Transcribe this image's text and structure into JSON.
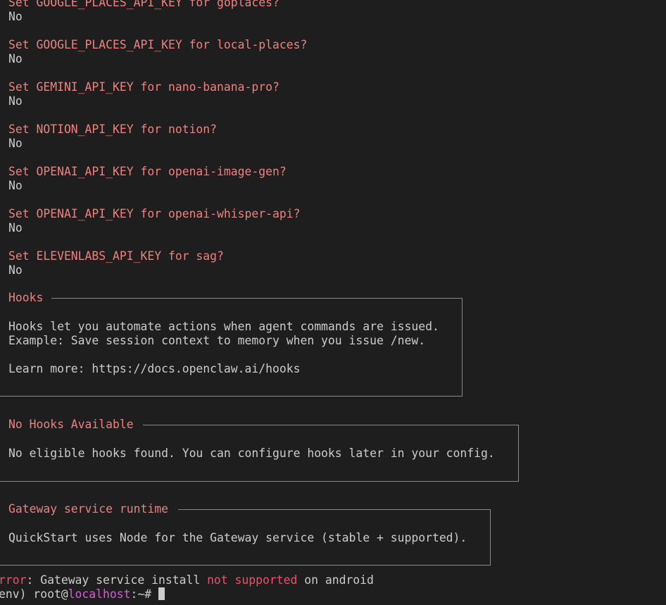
{
  "questions": [
    {
      "prompt": "Set GOOGLE_PLACES_API_KEY for goplaces?",
      "answer": "No"
    },
    {
      "prompt": "Set GOOGLE_PLACES_API_KEY for local-places?",
      "answer": "No"
    },
    {
      "prompt": "Set GEMINI_API_KEY for nano-banana-pro?",
      "answer": "No"
    },
    {
      "prompt": "Set NOTION_API_KEY for notion?",
      "answer": "No"
    },
    {
      "prompt": "Set OPENAI_API_KEY for openai-image-gen?",
      "answer": "No"
    },
    {
      "prompt": "Set OPENAI_API_KEY for openai-whisper-api?",
      "answer": "No"
    },
    {
      "prompt": "Set ELEVENLABS_API_KEY for sag?",
      "answer": "No"
    }
  ],
  "hooks_box": {
    "title": "Hooks",
    "line1": "Hooks let you automate actions when agent commands are issued.",
    "line2": "Example: Save session context to memory when you issue /new.",
    "line3": "Learn more: https://docs.openclaw.ai/hooks"
  },
  "no_hooks_box": {
    "title": "No Hooks Available",
    "line1": "No eligible hooks found. You can configure hooks later in your config."
  },
  "gateway_box": {
    "title": "Gateway service runtime",
    "line1": "QuickStart uses Node for the Gateway service (stable + supported)."
  },
  "error_line": {
    "prefix": "rror",
    "part1": ": Gateway service install ",
    "highlight": "not supported",
    "part2": " on android"
  },
  "prompt_line": {
    "env": "env) root@",
    "host": "localhost",
    "suffix": ":~# "
  }
}
